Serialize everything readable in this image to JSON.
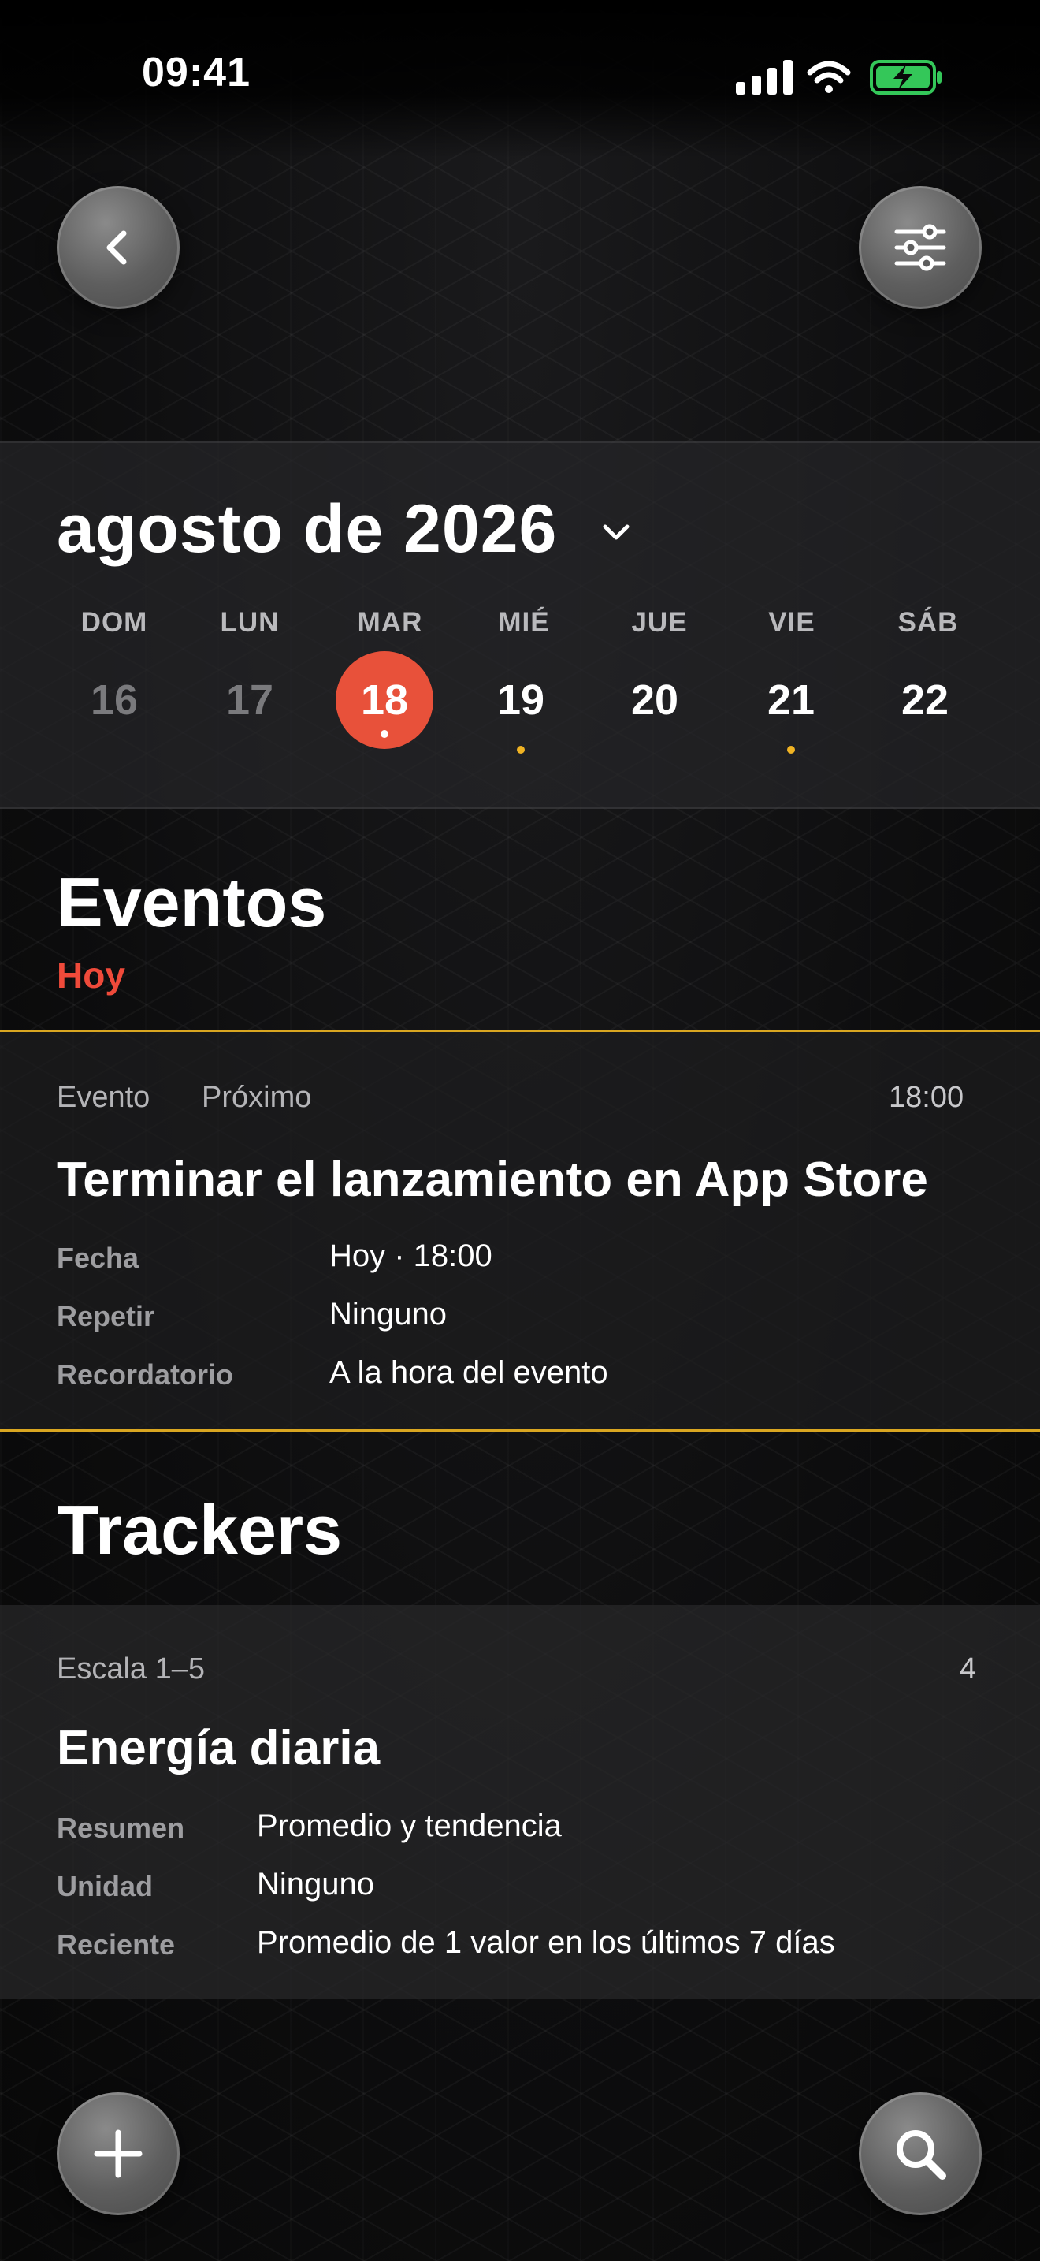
{
  "status_bar": {
    "time": "09:41"
  },
  "calendar": {
    "month_title": "agosto de 2026",
    "weekdays": [
      "DOM",
      "LUN",
      "MAR",
      "MIÉ",
      "JUE",
      "VIE",
      "SÁB"
    ],
    "days": [
      "16",
      "17",
      "18",
      "19",
      "20",
      "21",
      "22"
    ],
    "selected_day": "18"
  },
  "events": {
    "title": "Eventos",
    "subtitle": "Hoy",
    "card": {
      "type": "Evento",
      "status": "Próximo",
      "time": "18:00",
      "title": "Terminar el lanzamiento en App Store",
      "rows": [
        {
          "label": "Fecha",
          "value": "Hoy · 18:00"
        },
        {
          "label": "Repetir",
          "value": "Ninguno"
        },
        {
          "label": "Recordatorio",
          "value": "A la hora del evento"
        }
      ]
    }
  },
  "trackers": {
    "title": "Trackers",
    "card": {
      "scale": "Escala 1–5",
      "value": "4",
      "title": "Energía diaria",
      "rows": [
        {
          "label": "Resumen",
          "value": "Promedio y tendencia"
        },
        {
          "label": "Unidad",
          "value": "Ninguno"
        },
        {
          "label": "Reciente",
          "value": "Promedio de 1 valor en los últimos 7 días"
        }
      ]
    }
  },
  "colors": {
    "accent_red": "#e8513a",
    "today_label": "#ef4a3a",
    "event_border": "#d9a621",
    "event_dot": "#f0b323",
    "battery_green": "#34c759"
  },
  "icons": {
    "back": "chevron-left-icon",
    "filter": "sliders-icon",
    "add": "plus-icon",
    "search": "search-icon",
    "month_picker": "chevron-down-icon"
  }
}
